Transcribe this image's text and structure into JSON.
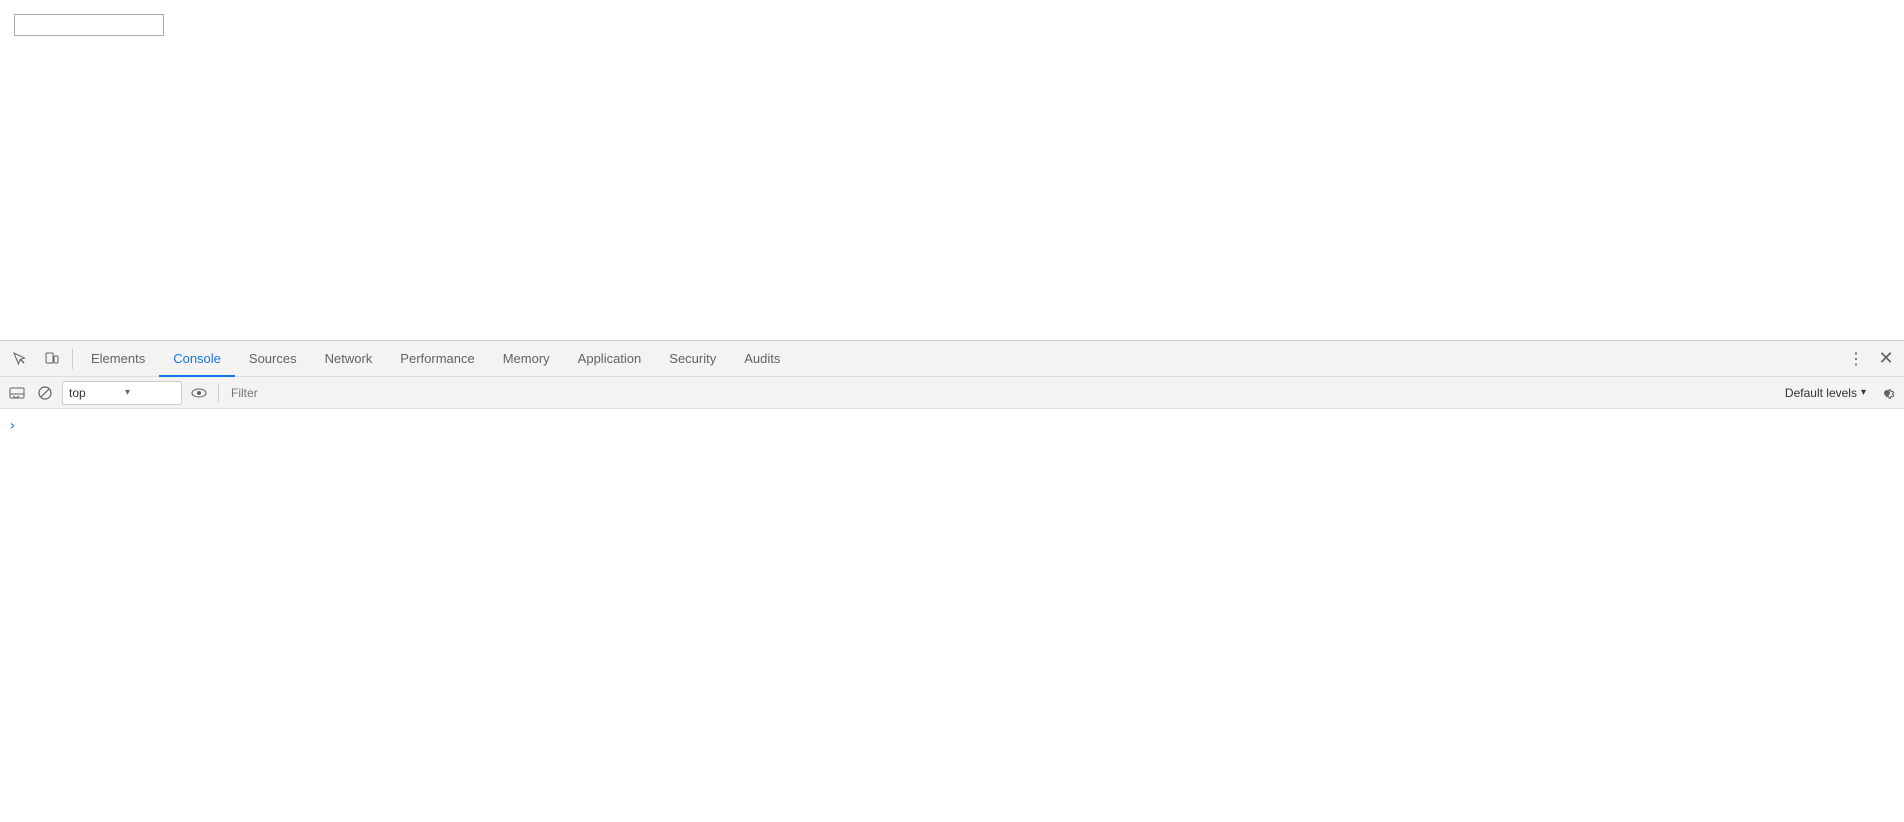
{
  "page": {
    "input_value": ""
  },
  "devtools": {
    "tabs": [
      {
        "id": "elements",
        "label": "Elements",
        "active": false
      },
      {
        "id": "console",
        "label": "Console",
        "active": true
      },
      {
        "id": "sources",
        "label": "Sources",
        "active": false
      },
      {
        "id": "network",
        "label": "Network",
        "active": false
      },
      {
        "id": "performance",
        "label": "Performance",
        "active": false
      },
      {
        "id": "memory",
        "label": "Memory",
        "active": false
      },
      {
        "id": "application",
        "label": "Application",
        "active": false
      },
      {
        "id": "security",
        "label": "Security",
        "active": false
      },
      {
        "id": "audits",
        "label": "Audits",
        "active": false
      }
    ],
    "console": {
      "context": "top",
      "context_dropdown_label": "top",
      "filter_placeholder": "Filter",
      "default_levels_label": "Default levels"
    }
  }
}
